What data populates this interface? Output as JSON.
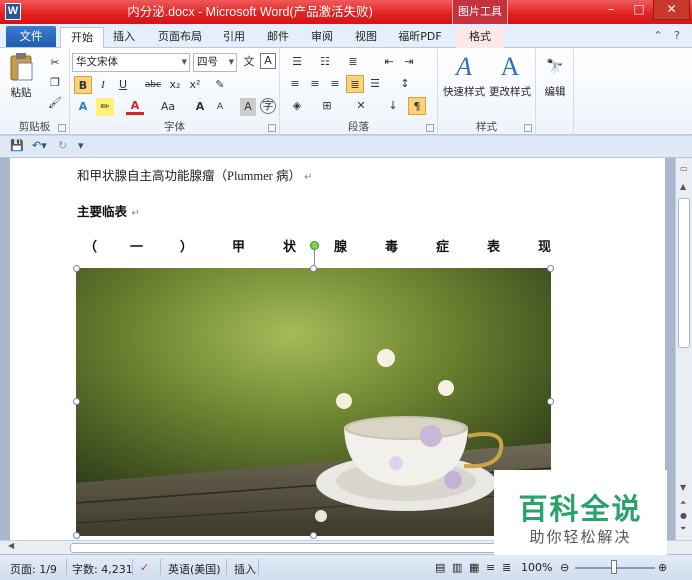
{
  "window": {
    "title": "内分泌.docx - Microsoft Word(产品激活失败)",
    "context_tab": "图片工具",
    "minimize": "–",
    "maximize": "□",
    "close": "✕"
  },
  "tabs": {
    "file": "文件",
    "items": [
      "开始",
      "插入",
      "页面布局",
      "引用",
      "邮件",
      "审阅",
      "视图",
      "福昕PDF",
      "格式"
    ],
    "active": "开始"
  },
  "ribbon": {
    "clipboard": {
      "paste": "粘贴",
      "label": "剪贴板"
    },
    "font": {
      "font_name": "华文宋体",
      "font_size": "四号",
      "bold": "B",
      "italic": "I",
      "underline": "U",
      "strike": "abc",
      "subscript": "x₂",
      "superscript": "x²",
      "grow": "A",
      "shrink": "A",
      "aa": "Aa",
      "label": "字体"
    },
    "paragraph": {
      "label": "段落"
    },
    "styles": {
      "quick": "快速样式",
      "change": "更改样式",
      "label": "样式"
    },
    "editing": {
      "label": "编辑"
    }
  },
  "document": {
    "line1": "和甲状腺自主高功能腺瘤（Plummer 病）",
    "heading": "主要临表",
    "spaced_chars": [
      "（",
      "一",
      "）",
      "甲",
      "状",
      "腺",
      "毒",
      "症",
      "表",
      "现"
    ]
  },
  "status": {
    "page": "页面: 1/9",
    "words": "字数: 4,231",
    "language": "英语(美国)",
    "mode": "插入",
    "zoom": "100%"
  },
  "watermark": {
    "title": "百科全说",
    "subtitle": "助你轻松解决"
  },
  "colors": {
    "titlebar": "#e11f1f",
    "file_tab": "#1f5cb1",
    "watermark_green": "#27a36b"
  }
}
